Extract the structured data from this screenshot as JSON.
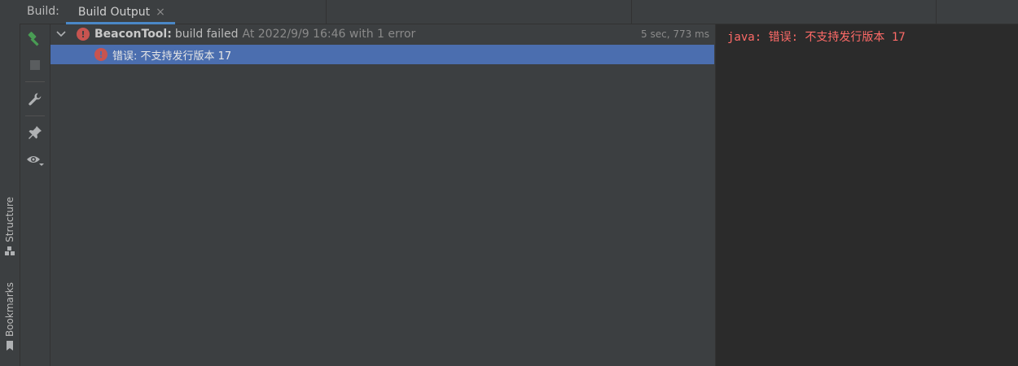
{
  "header": {
    "build_label": "Build:",
    "tab_label": "Build Output",
    "tab_close": "×"
  },
  "side_tabs": {
    "structure": "Structure",
    "bookmarks": "Bookmarks"
  },
  "toolbar": {
    "buttons": [
      "hammer-icon",
      "stop-icon",
      "wrench-icon",
      "pin-icon",
      "eye-icon"
    ]
  },
  "tree": {
    "root": {
      "project": "BeaconTool:",
      "status": "build failed",
      "meta": "At 2022/9/9 16:46 with 1 error",
      "timing": "5 sec, 773 ms",
      "expanded": true
    },
    "child": {
      "text": "错误: 不支持发行版本 17",
      "selected": true
    }
  },
  "console": {
    "lines": [
      "java: 错误: 不支持发行版本 17"
    ]
  },
  "colors": {
    "error": "#c75450",
    "selection": "#4b6eaf",
    "console_error_text": "#ff6b68",
    "tab_underline": "#4a88c7",
    "hammer": "#499c54"
  }
}
